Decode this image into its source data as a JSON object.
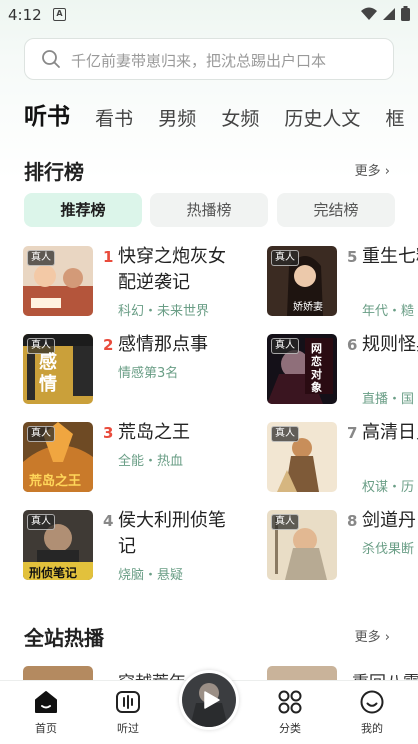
{
  "status": {
    "time": "4:12",
    "notification_letter": "A"
  },
  "search": {
    "placeholder": "千亿前妻带崽归来，把沈总踢出户口本"
  },
  "tabs": [
    "听书",
    "看书",
    "男频",
    "女频",
    "历史人文",
    "框"
  ],
  "ranking": {
    "title": "排行榜",
    "more_label": "更多",
    "subtabs": [
      "推荐榜",
      "热播榜",
      "完结榜"
    ],
    "left_items": [
      {
        "rank": "1",
        "title": "快穿之炮灰女配逆袭记",
        "meta": "科幻・未来世界",
        "tag": "真人",
        "cover_text": ""
      },
      {
        "rank": "2",
        "title": "感情那点事",
        "meta": "情感第3名",
        "tag": "真人",
        "cover_text": "感情"
      },
      {
        "rank": "3",
        "title": "荒岛之王",
        "meta": "全能・热血",
        "tag": "真人",
        "cover_text": "荒岛之王"
      },
      {
        "rank": "4",
        "title": "侯大利刑侦笔记",
        "meta": "烧脑・悬疑",
        "tag": "真人",
        "cover_text": "刑侦笔记"
      }
    ],
    "right_items": [
      {
        "rank": "5",
        "title": "重生七糙汉的",
        "meta": "年代・糙",
        "tag": "真人",
        "cover_text": "娇娇妻"
      },
      {
        "rank": "6",
        "title": "规则怪异的网",
        "meta": "直播・国",
        "tag": "真人",
        "cover_text": "网恋对象"
      },
      {
        "rank": "7",
        "title": "高清日史",
        "meta": "权谋・历",
        "tag": "真人",
        "cover_text": ""
      },
      {
        "rank": "8",
        "title": "剑道丹",
        "meta": "杀伐果断",
        "tag": "真人",
        "cover_text": ""
      }
    ]
  },
  "hot": {
    "title": "全站热播",
    "more_label": "更多",
    "peek_left": "穿越荒年",
    "peek_right": "重回八零"
  },
  "nav": {
    "items": [
      "首页",
      "听过",
      "分类",
      "我的"
    ]
  },
  "colors": {
    "accent": "#3dbb8d",
    "rank_hot": "#e94b3c",
    "meta_green": "#6a9e86"
  }
}
